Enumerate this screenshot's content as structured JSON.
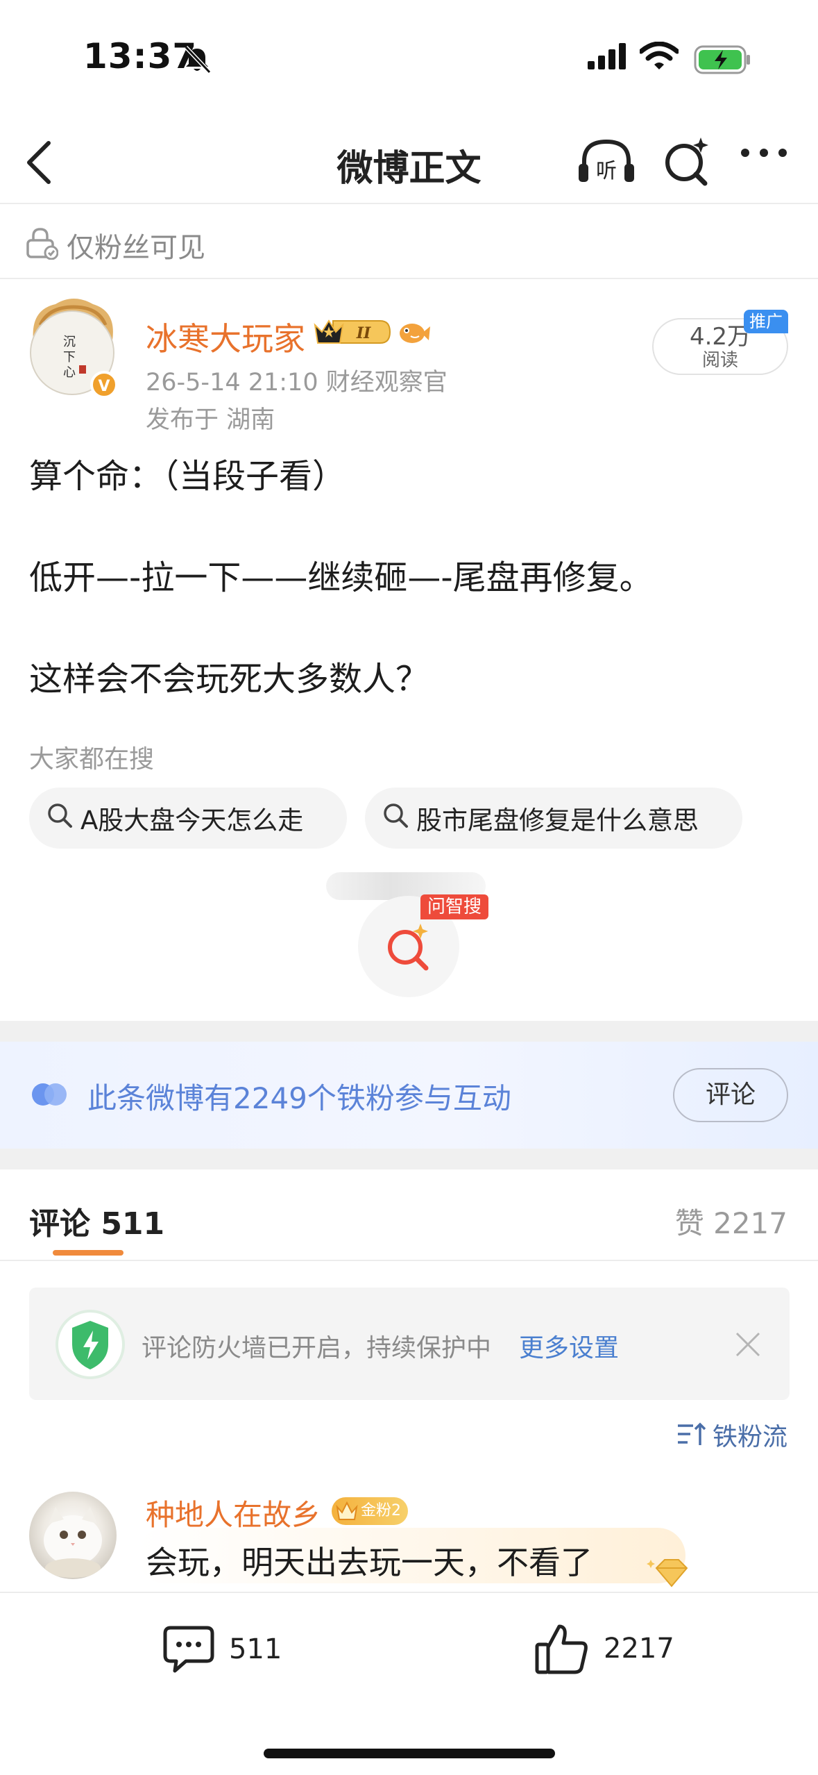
{
  "status_bar": {
    "time": "13:37"
  },
  "nav": {
    "title": "微博正文",
    "listen_glyph": "听"
  },
  "visibility": {
    "text": "仅粉丝可见"
  },
  "post": {
    "author": "冰寒大玩家",
    "level_badge": "II",
    "meta": "26-5-14 21:10  财经观察官",
    "location": "发布于 湖南",
    "read_count": "4.2万",
    "read_label": "阅读",
    "promo_tag": "推广",
    "paragraphs": [
      "算个命：（当段子看）",
      "低开—-拉一下——继续砸—-尾盘再修复。",
      "这样会不会玩死大多数人？"
    ]
  },
  "search_suggestions": {
    "heading": "大家都在搜",
    "items": [
      "A股大盘今天怎么走",
      "股市尾盘修复是什么意思"
    ]
  },
  "ask": {
    "tag": "问智搜"
  },
  "fans_banner": {
    "text": "此条微博有2249个铁粉参与互动",
    "button": "评论"
  },
  "comments_header": {
    "comments_tab": "评论 511",
    "likes_tab": "赞 2217"
  },
  "firewall": {
    "text": "评论防火墙已开启，持续保护中",
    "link": "更多设置"
  },
  "sort": {
    "label": "铁粉流"
  },
  "comments": [
    {
      "name": "种地人在故乡",
      "badge": "金粉2",
      "text": "会玩，明天出去玩一天，不看了"
    }
  ],
  "bottom_bar": {
    "comment_count": "511",
    "like_count": "2217"
  },
  "colors": {
    "username": "#e8722c",
    "link_blue": "#4a7fcf",
    "fans_blue": "#5b83d8",
    "tab_underline": "#f08a3c",
    "ask_red": "#ee4b3b"
  }
}
